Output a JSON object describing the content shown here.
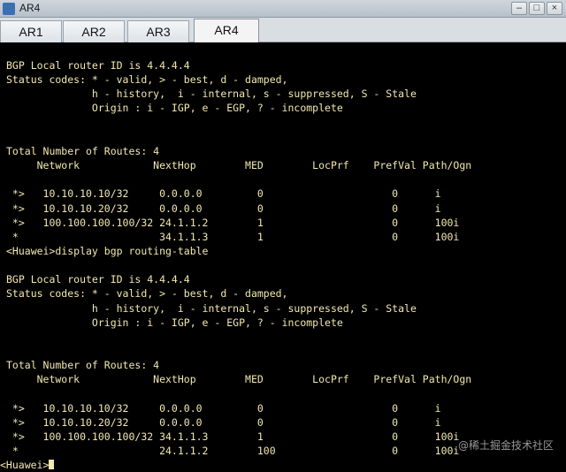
{
  "window": {
    "title": "AR4",
    "tabs": [
      {
        "label": "AR1"
      },
      {
        "label": "AR2"
      },
      {
        "label": "AR3"
      },
      {
        "label": "AR4"
      }
    ],
    "controls": [
      "minimize-icon",
      "maximize-icon",
      "close-icon"
    ]
  },
  "terminal": {
    "lines": [
      "BGP Local router ID is 4.4.4.4",
      "Status codes: * - valid, > - best, d - damped,",
      "              h - history,  i - internal, s - suppressed, S - Stale",
      "              Origin : i - IGP, e - EGP, ? - incomplete",
      "",
      "",
      "Total Number of Routes: 4",
      "     Network            NextHop        MED        LocPrf    PrefVal Path/Ogn",
      "",
      " *>   10.10.10.10/32     0.0.0.0         0                     0      i",
      " *>   10.10.10.20/32     0.0.0.0         0                     0      i",
      " *>   100.100.100.100/32 24.1.1.2        1                     0      100i",
      " *                       34.1.1.3        1                     0      100i",
      "<Huawei>display bgp routing-table",
      "",
      "BGP Local router ID is 4.4.4.4",
      "Status codes: * - valid, > - best, d - damped,",
      "              h - history,  i - internal, s - suppressed, S - Stale",
      "              Origin : i - IGP, e - EGP, ? - incomplete",
      "",
      "",
      "Total Number of Routes: 4",
      "     Network            NextHop        MED        LocPrf    PrefVal Path/Ogn",
      "",
      " *>   10.10.10.10/32     0.0.0.0         0                     0      i",
      " *>   10.10.10.20/32     0.0.0.0         0                     0      i",
      " *>   100.100.100.100/32 34.1.1.3        1                     0      100i",
      " *                       24.1.1.2        100                   0      100i"
    ],
    "prompt": "<Huawei>"
  },
  "watermark": "@稀土掘金技术社区",
  "colors": {
    "terminal_bg": "#000000",
    "terminal_text": "#f2e8b0"
  }
}
